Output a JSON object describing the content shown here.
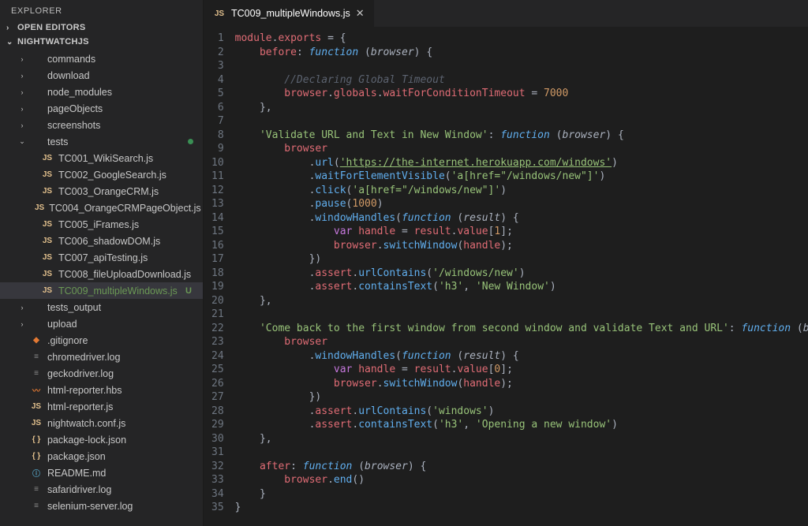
{
  "explorer": {
    "title": "EXPLORER",
    "sections": {
      "openEditors": "OPEN EDITORS",
      "project": "NIGHTWATCHJS"
    },
    "folders_top": [
      "commands",
      "download",
      "node_modules",
      "pageObjects",
      "screenshots"
    ],
    "tests_folder": "tests",
    "tests_files": [
      "TC001_WikiSearch.js",
      "TC002_GoogleSearch.js",
      "TC003_OrangeCRM.js",
      "TC004_OrangeCRMPageObject.js",
      "TC005_iFrames.js",
      "TC006_shadowDOM.js",
      "TC007_apiTesting.js",
      "TC008_fileUploadDownload.js",
      "TC009_multipleWindows.js"
    ],
    "folders_bottom": [
      "tests_output",
      "upload"
    ],
    "root_files": [
      {
        "name": ".gitignore",
        "icon": "git"
      },
      {
        "name": "chromedriver.log",
        "icon": "log"
      },
      {
        "name": "geckodriver.log",
        "icon": "log"
      },
      {
        "name": "html-reporter.hbs",
        "icon": "hbs"
      },
      {
        "name": "html-reporter.js",
        "icon": "js"
      },
      {
        "name": "nightwatch.conf.js",
        "icon": "js"
      },
      {
        "name": "package-lock.json",
        "icon": "json"
      },
      {
        "name": "package.json",
        "icon": "json"
      },
      {
        "name": "README.md",
        "icon": "md"
      },
      {
        "name": "safaridriver.log",
        "icon": "log"
      },
      {
        "name": "selenium-server.log",
        "icon": "log"
      }
    ],
    "active_index": 8,
    "status_badge": "U"
  },
  "tab": {
    "icon": "JS",
    "filename": "TC009_multipleWindows.js"
  },
  "icons": {
    "js_label": "JS",
    "json_label": "{ }",
    "log_label": "≡",
    "md_label": "ⓘ",
    "hbs_label": "〰",
    "git_label": "◆",
    "folder_chev": "›",
    "folder_open": "⌄",
    "section_chev": "›",
    "close": "✕"
  },
  "code": {
    "lines": [
      [
        [
          "obj",
          "module"
        ],
        [
          "punct",
          "."
        ],
        [
          "obj",
          "exports"
        ],
        [
          "punct",
          " = "
        ],
        [
          "punct",
          "{"
        ]
      ],
      [
        [
          "punct",
          "    "
        ],
        [
          "prop",
          "before"
        ],
        [
          "punct",
          ": "
        ],
        [
          "func",
          "function"
        ],
        [
          "punct",
          " ("
        ],
        [
          "param",
          "browser"
        ],
        [
          "punct",
          ") {"
        ]
      ],
      [
        [
          "punct",
          ""
        ]
      ],
      [
        [
          "punct",
          "        "
        ],
        [
          "cmt",
          "//Declaring Global Timeout"
        ]
      ],
      [
        [
          "punct",
          "        "
        ],
        [
          "obj",
          "browser"
        ],
        [
          "punct",
          "."
        ],
        [
          "obj",
          "globals"
        ],
        [
          "punct",
          "."
        ],
        [
          "obj",
          "waitForConditionTimeout"
        ],
        [
          "punct",
          " = "
        ],
        [
          "num",
          "7000"
        ]
      ],
      [
        [
          "punct",
          "    },"
        ]
      ],
      [
        [
          "punct",
          ""
        ]
      ],
      [
        [
          "punct",
          "    "
        ],
        [
          "str",
          "'Validate URL and Text in New Window'"
        ],
        [
          "punct",
          ": "
        ],
        [
          "func",
          "function"
        ],
        [
          "punct",
          " ("
        ],
        [
          "param",
          "browser"
        ],
        [
          "punct",
          ") {"
        ]
      ],
      [
        [
          "punct",
          "        "
        ],
        [
          "obj",
          "browser"
        ]
      ],
      [
        [
          "punct",
          "            ."
        ],
        [
          "funcname",
          "url"
        ],
        [
          "punct",
          "("
        ],
        [
          "url",
          "'https://the-internet.herokuapp.com/windows'"
        ],
        [
          "punct",
          ")"
        ]
      ],
      [
        [
          "punct",
          "            ."
        ],
        [
          "funcname",
          "waitForElementVisible"
        ],
        [
          "punct",
          "("
        ],
        [
          "str",
          "'a[href=\"/windows/new\"]'"
        ],
        [
          "punct",
          ")"
        ]
      ],
      [
        [
          "punct",
          "            ."
        ],
        [
          "funcname",
          "click"
        ],
        [
          "punct",
          "("
        ],
        [
          "str",
          "'a[href=\"/windows/new\"]'"
        ],
        [
          "punct",
          ")"
        ]
      ],
      [
        [
          "punct",
          "            ."
        ],
        [
          "funcname",
          "pause"
        ],
        [
          "punct",
          "("
        ],
        [
          "num",
          "1000"
        ],
        [
          "punct",
          ")"
        ]
      ],
      [
        [
          "punct",
          "            ."
        ],
        [
          "funcname",
          "windowHandles"
        ],
        [
          "punct",
          "("
        ],
        [
          "func",
          "function"
        ],
        [
          "punct",
          " ("
        ],
        [
          "param",
          "result"
        ],
        [
          "punct",
          ") {"
        ]
      ],
      [
        [
          "punct",
          "                "
        ],
        [
          "kw",
          "var"
        ],
        [
          "punct",
          " "
        ],
        [
          "obj",
          "handle"
        ],
        [
          "punct",
          " = "
        ],
        [
          "obj",
          "result"
        ],
        [
          "punct",
          "."
        ],
        [
          "obj",
          "value"
        ],
        [
          "punct",
          "["
        ],
        [
          "num",
          "1"
        ],
        [
          "punct",
          "];"
        ]
      ],
      [
        [
          "punct",
          "                "
        ],
        [
          "obj",
          "browser"
        ],
        [
          "punct",
          "."
        ],
        [
          "funcname",
          "switchWindow"
        ],
        [
          "punct",
          "("
        ],
        [
          "obj",
          "handle"
        ],
        [
          "punct",
          ");"
        ]
      ],
      [
        [
          "punct",
          "            })"
        ]
      ],
      [
        [
          "punct",
          "            ."
        ],
        [
          "obj",
          "assert"
        ],
        [
          "punct",
          "."
        ],
        [
          "funcname",
          "urlContains"
        ],
        [
          "punct",
          "("
        ],
        [
          "str",
          "'/windows/new'"
        ],
        [
          "punct",
          ")"
        ]
      ],
      [
        [
          "punct",
          "            ."
        ],
        [
          "obj",
          "assert"
        ],
        [
          "punct",
          "."
        ],
        [
          "funcname",
          "containsText"
        ],
        [
          "punct",
          "("
        ],
        [
          "str",
          "'h3'"
        ],
        [
          "punct",
          ", "
        ],
        [
          "str",
          "'New Window'"
        ],
        [
          "punct",
          ")"
        ]
      ],
      [
        [
          "punct",
          "    },"
        ]
      ],
      [
        [
          "punct",
          ""
        ]
      ],
      [
        [
          "punct",
          "    "
        ],
        [
          "str",
          "'Come back to the first window from second window and validate Text and URL'"
        ],
        [
          "punct",
          ": "
        ],
        [
          "func",
          "function"
        ],
        [
          "punct",
          " ("
        ],
        [
          "param",
          "browser"
        ],
        [
          "punct",
          ")"
        ]
      ],
      [
        [
          "punct",
          "        "
        ],
        [
          "obj",
          "browser"
        ]
      ],
      [
        [
          "punct",
          "            ."
        ],
        [
          "funcname",
          "windowHandles"
        ],
        [
          "punct",
          "("
        ],
        [
          "func",
          "function"
        ],
        [
          "punct",
          " ("
        ],
        [
          "param",
          "result"
        ],
        [
          "punct",
          ") {"
        ]
      ],
      [
        [
          "punct",
          "                "
        ],
        [
          "kw",
          "var"
        ],
        [
          "punct",
          " "
        ],
        [
          "obj",
          "handle"
        ],
        [
          "punct",
          " = "
        ],
        [
          "obj",
          "result"
        ],
        [
          "punct",
          "."
        ],
        [
          "obj",
          "value"
        ],
        [
          "punct",
          "["
        ],
        [
          "num",
          "0"
        ],
        [
          "punct",
          "];"
        ]
      ],
      [
        [
          "punct",
          "                "
        ],
        [
          "obj",
          "browser"
        ],
        [
          "punct",
          "."
        ],
        [
          "funcname",
          "switchWindow"
        ],
        [
          "punct",
          "("
        ],
        [
          "obj",
          "handle"
        ],
        [
          "punct",
          ");"
        ]
      ],
      [
        [
          "punct",
          "            })"
        ]
      ],
      [
        [
          "punct",
          "            ."
        ],
        [
          "obj",
          "assert"
        ],
        [
          "punct",
          "."
        ],
        [
          "funcname",
          "urlContains"
        ],
        [
          "punct",
          "("
        ],
        [
          "str",
          "'windows'"
        ],
        [
          "punct",
          ")"
        ]
      ],
      [
        [
          "punct",
          "            ."
        ],
        [
          "obj",
          "assert"
        ],
        [
          "punct",
          "."
        ],
        [
          "funcname",
          "containsText"
        ],
        [
          "punct",
          "("
        ],
        [
          "str",
          "'h3'"
        ],
        [
          "punct",
          ", "
        ],
        [
          "str",
          "'Opening a new window'"
        ],
        [
          "punct",
          ")"
        ]
      ],
      [
        [
          "punct",
          "    },"
        ]
      ],
      [
        [
          "punct",
          ""
        ]
      ],
      [
        [
          "punct",
          "    "
        ],
        [
          "prop",
          "after"
        ],
        [
          "punct",
          ": "
        ],
        [
          "func",
          "function"
        ],
        [
          "punct",
          " ("
        ],
        [
          "param",
          "browser"
        ],
        [
          "punct",
          ") {"
        ]
      ],
      [
        [
          "punct",
          "        "
        ],
        [
          "obj",
          "browser"
        ],
        [
          "punct",
          "."
        ],
        [
          "funcname",
          "end"
        ],
        [
          "punct",
          "()"
        ]
      ],
      [
        [
          "punct",
          "    }"
        ]
      ],
      [
        [
          "punct",
          "}"
        ]
      ]
    ]
  }
}
